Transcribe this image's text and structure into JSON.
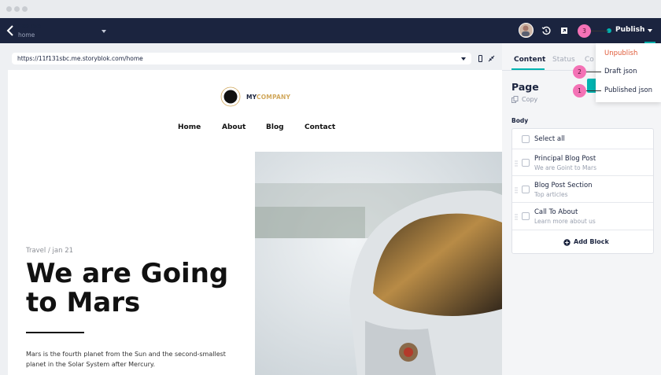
{
  "topbar": {
    "title": "Home",
    "subtitle": "home",
    "publish_label": "Publish"
  },
  "preview": {
    "url": "https://11f131sbc.me.storyblok.com/home",
    "logo": {
      "part1": "MY",
      "part2": "COMPANY"
    },
    "nav": [
      "Home",
      "About",
      "Blog",
      "Contact"
    ],
    "date": "Travel / jan 21",
    "headline": "We are Going to Mars",
    "paragraph": "Mars is the fourth planet from the Sun and the second-smallest planet in the Solar System after Mercury."
  },
  "panel": {
    "tabs": [
      "Content",
      "Status",
      "Co"
    ],
    "title": "Page",
    "copy_label": "Copy",
    "body_label": "Body",
    "select_all": "Select all",
    "blocks": [
      {
        "title": "Principal Blog Post",
        "sub": "We are Goint to Mars"
      },
      {
        "title": "Blog Post Section",
        "sub": "Top articles"
      },
      {
        "title": "Call To About",
        "sub": "Learn more about us"
      }
    ],
    "add_block": "Add Block"
  },
  "dropdown": {
    "items": [
      "Unpublish",
      "Draft json",
      "Published json"
    ]
  },
  "markers": [
    "1",
    "2",
    "3"
  ],
  "colors": {
    "topbar": "#1b243f",
    "accent": "#00b3b0",
    "unpublish": "#e05a38",
    "marker": "#f472b6",
    "logo_gold": "#d1a85c"
  }
}
